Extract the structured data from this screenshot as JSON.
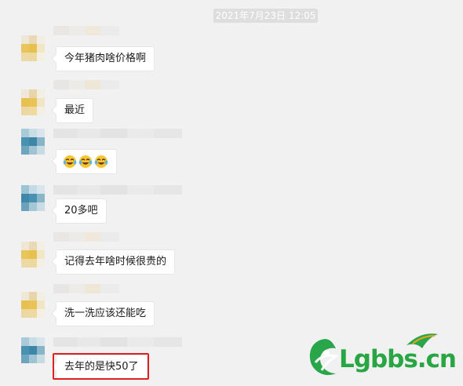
{
  "chat": {
    "timestamp": "2021年7月23日 12:05",
    "messages": [
      {
        "text": "今年猪肉啥价格啊",
        "avatar": "yellow"
      },
      {
        "text": "最近",
        "avatar": "yellow"
      },
      {
        "text": "",
        "emoji_count": 3,
        "avatar": "blue"
      },
      {
        "text": "20多吧",
        "avatar": "blue"
      },
      {
        "text": "记得去年啥时候很贵的",
        "avatar": "yellow"
      },
      {
        "text": "洗一洗应该还能吃",
        "avatar": "yellow"
      },
      {
        "text": "去年的是快50了",
        "avatar": "blue"
      }
    ]
  },
  "watermark": {
    "text": "Lgbbs.cn"
  },
  "colors": {
    "accent_red": "#e02020",
    "watermark_green": "#27a643",
    "background": "#f1f1f1"
  },
  "icons": {
    "emoji": "tears-of-joy-emoji-icon"
  }
}
